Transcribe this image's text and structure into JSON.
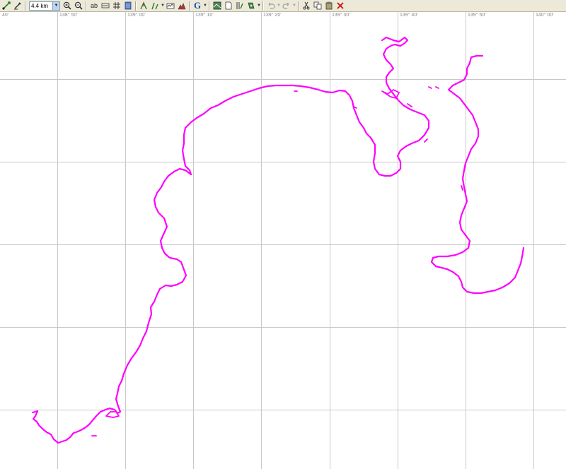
{
  "toolbar": {
    "scale_value": "4.4 km",
    "text_tool_label": "ab",
    "google_label": "G"
  },
  "ruler": {
    "longitude_labels": [
      {
        "label": "40'"
      },
      {
        "label": "138° 50'"
      },
      {
        "label": "139° 00'"
      },
      {
        "label": "139° 10'"
      },
      {
        "label": "139° 20'"
      },
      {
        "label": "139° 30'"
      },
      {
        "label": "139° 40'"
      },
      {
        "label": "139° 50'"
      },
      {
        "label": "140° 00'"
      }
    ]
  },
  "map": {
    "track_color": "#ff00ff",
    "grid_color": "#c8c8c8"
  }
}
